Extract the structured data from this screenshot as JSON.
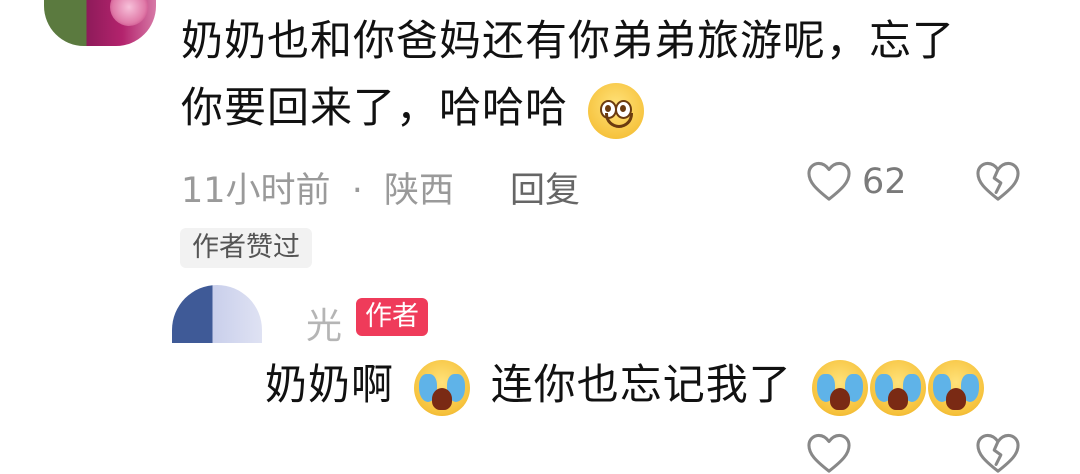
{
  "comment": {
    "text_line1": "奶奶也和你爸妈还有你弟弟旅游呢，忘了",
    "text_line2": "你要回来了，哈哈哈",
    "time": "11小时前",
    "separator": "·",
    "location": "陕西",
    "reply_label": "回复",
    "like_count": "62",
    "liked_by_author_tag": "作者赞过"
  },
  "reply": {
    "author_name": "光",
    "author_badge": "作者",
    "text_part1": "奶奶啊",
    "text_part2": "连你也忘记我了"
  },
  "colors": {
    "meta_gray": "#9a9a9a",
    "badge_red": "#ef3b5a"
  },
  "icons": [
    "smile-emoji-icon",
    "crying-emoji-icon",
    "heart-icon",
    "broken-heart-icon"
  ]
}
